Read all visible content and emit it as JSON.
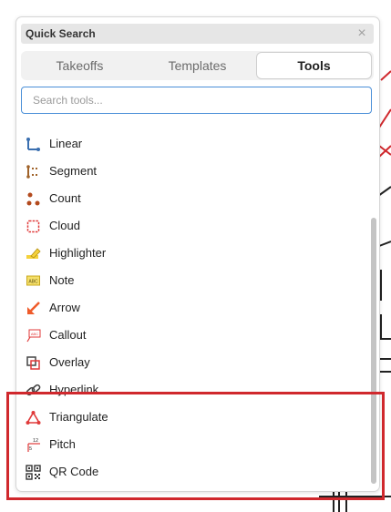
{
  "panel": {
    "title": "Quick Search",
    "close_glyph": "×"
  },
  "tabs": [
    {
      "label": "Takeoffs",
      "active": false
    },
    {
      "label": "Templates",
      "active": false
    },
    {
      "label": "Tools",
      "active": true
    }
  ],
  "search": {
    "placeholder": "Search tools...",
    "value": ""
  },
  "tools": [
    {
      "label": "Linear",
      "icon": "linear-icon"
    },
    {
      "label": "Segment",
      "icon": "segment-icon"
    },
    {
      "label": "Count",
      "icon": "count-icon"
    },
    {
      "label": "Cloud",
      "icon": "cloud-icon"
    },
    {
      "label": "Highlighter",
      "icon": "highlighter-icon"
    },
    {
      "label": "Note",
      "icon": "note-icon"
    },
    {
      "label": "Arrow",
      "icon": "arrow-icon"
    },
    {
      "label": "Callout",
      "icon": "callout-icon"
    },
    {
      "label": "Overlay",
      "icon": "overlay-icon"
    },
    {
      "label": "Hyperlink",
      "icon": "hyperlink-icon"
    },
    {
      "label": "Triangulate",
      "icon": "triangulate-icon"
    },
    {
      "label": "Pitch",
      "icon": "pitch-icon"
    },
    {
      "label": "QR Code",
      "icon": "qr-code-icon"
    }
  ],
  "icon_text": {
    "note": "ABC",
    "callout": "ABC",
    "pitch_top": "12",
    "pitch_side": "5"
  },
  "colors": {
    "accent_blue": "#4a8fd8",
    "highlight_red": "#d0282d",
    "linear_blue": "#3a6fb0",
    "segment_brown": "#a0632a",
    "count_brown": "#b34a1e",
    "cloud_red": "#e03a3a",
    "highlighter_yellow": "#f5d23c",
    "arrow_orange": "#ef5b2a"
  }
}
